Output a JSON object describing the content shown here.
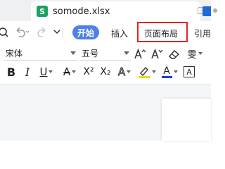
{
  "tab": {
    "icon_letter": "S",
    "title": "somode.xlsx"
  },
  "menu": {
    "start": "开始",
    "insert": "插入",
    "page_layout": "页面布局",
    "references": "引用"
  },
  "font": {
    "family": "宋体",
    "size": "五号",
    "phonetic_glyph": "雯"
  },
  "format": {
    "bold": "B",
    "italic": "I",
    "underline": "U",
    "strikethrough": "A",
    "superscript": "X²",
    "subscript": "X₂",
    "text_effect": "A",
    "font_color": "A",
    "char_border": "A"
  },
  "colors": {
    "accent_blue": "#4f7fe8",
    "sheet_green": "#1aa260",
    "highlight_yellow": "#f5d90a",
    "font_color_blue": "#1f3fd6",
    "selection_red": "#e02424"
  }
}
